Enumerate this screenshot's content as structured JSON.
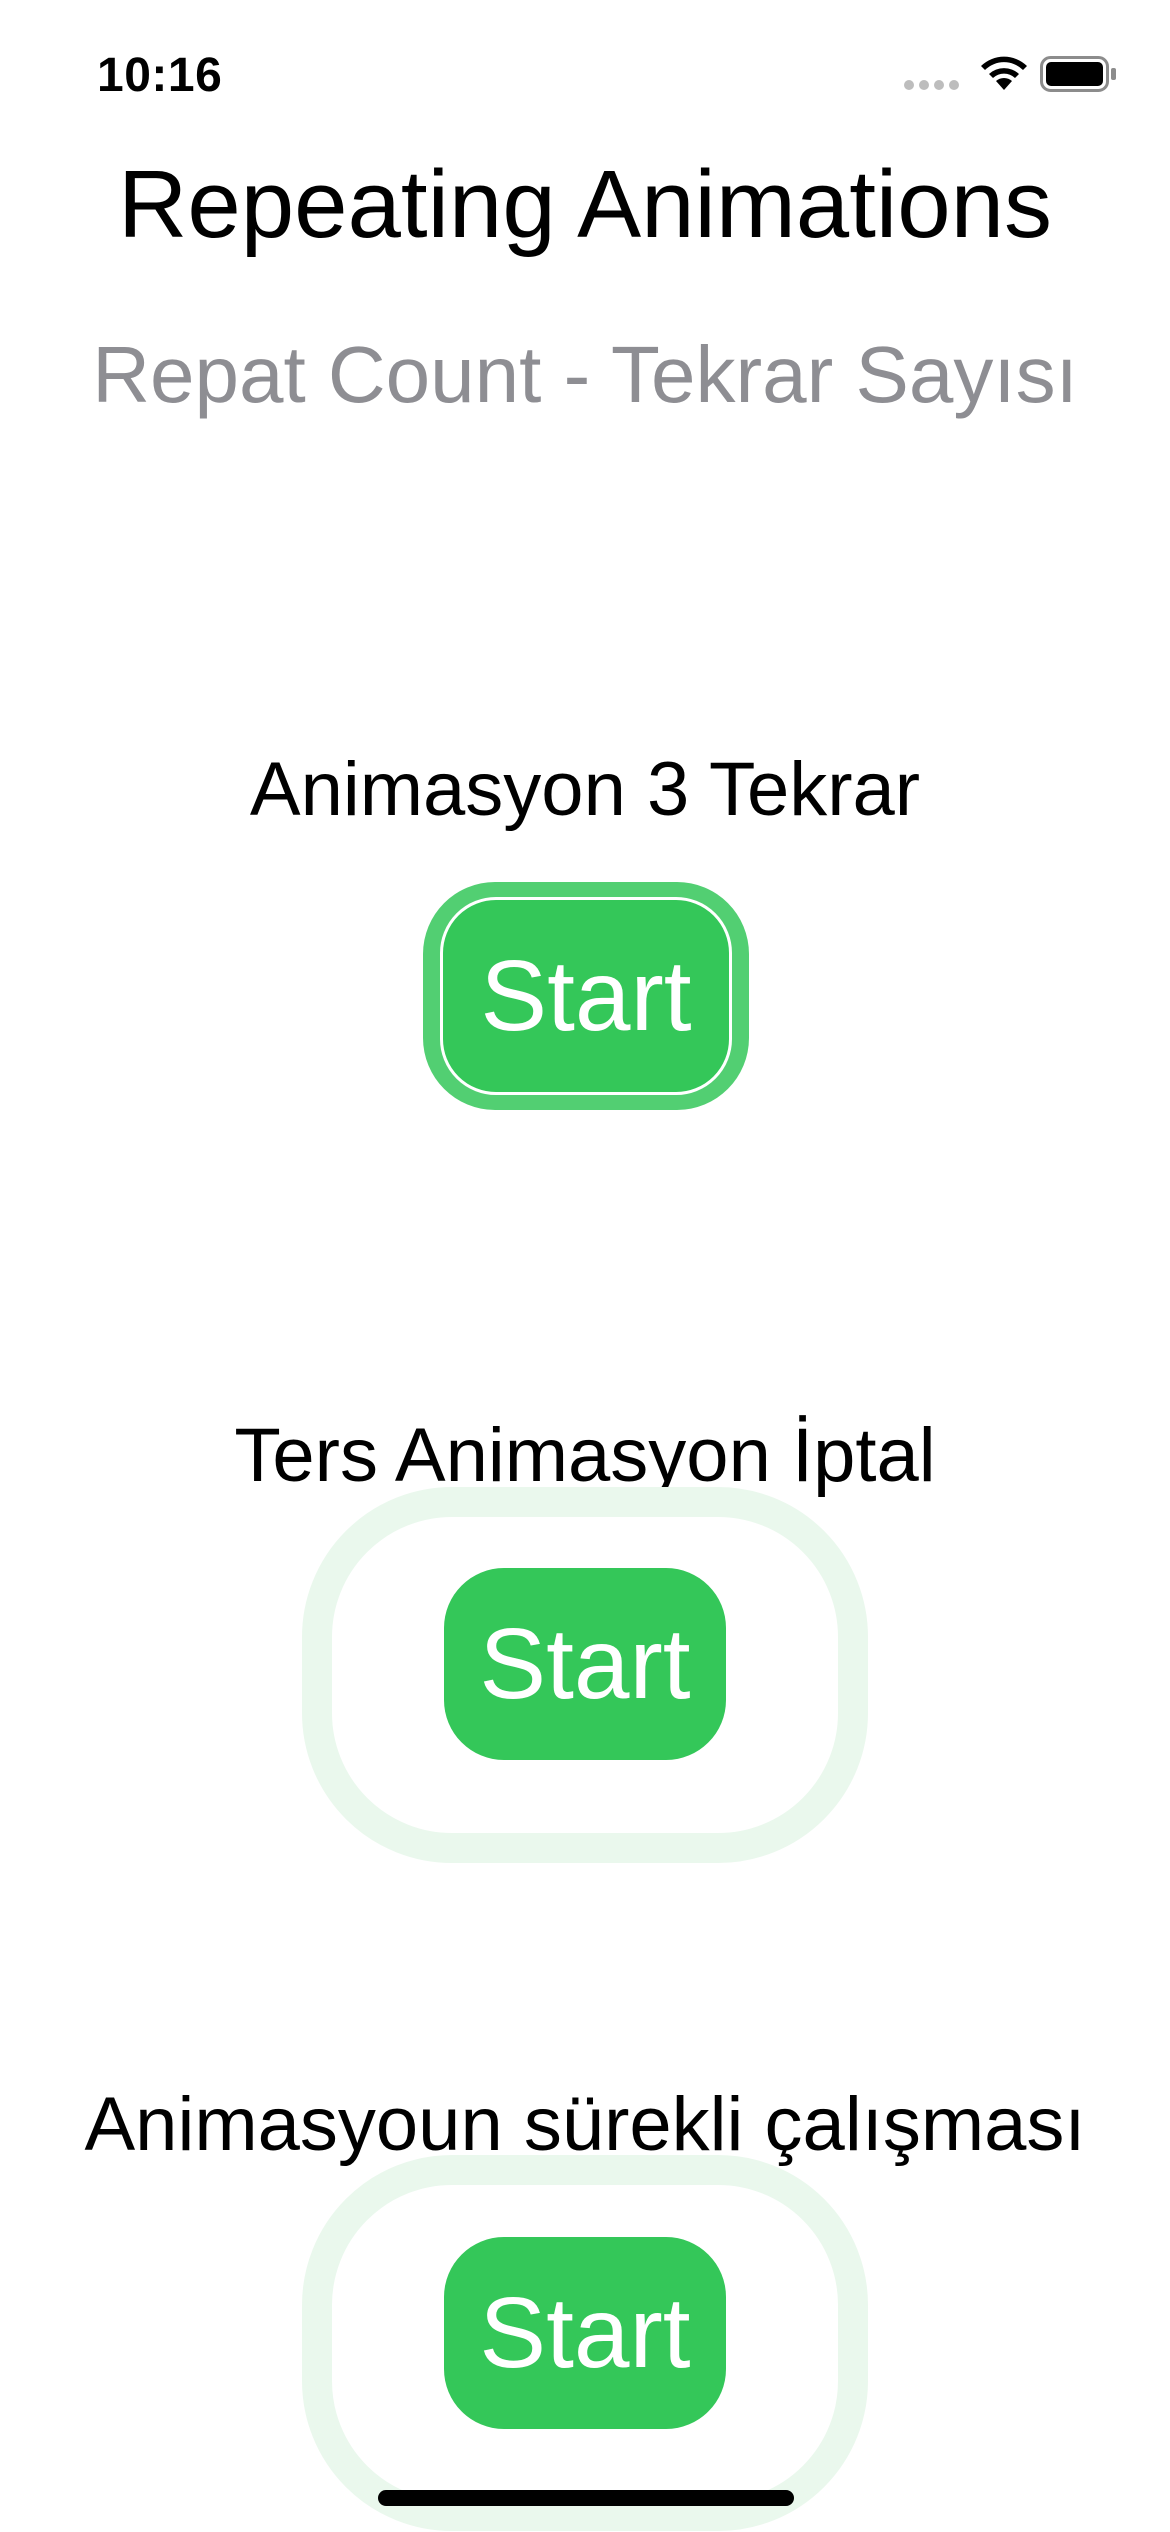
{
  "status_bar": {
    "time": "10:16",
    "icons": [
      "cellular-dots-icon",
      "wifi-icon",
      "battery-icon"
    ]
  },
  "header": {
    "title": "Repeating Animations",
    "subtitle": "Repat Count - Tekrar Sayısı"
  },
  "sections": [
    {
      "label": "Animasyon 3 Tekrar",
      "button_label": "Start"
    },
    {
      "label": "Ters Animasyon İptal",
      "button_label": "Start"
    },
    {
      "label": "Animasyoun sürekli çalışması",
      "button_label": "Start"
    }
  ],
  "colors": {
    "accent": "#34c759",
    "subtitle": "#8e8e93",
    "pulse_ring": "#eaf8ed"
  }
}
